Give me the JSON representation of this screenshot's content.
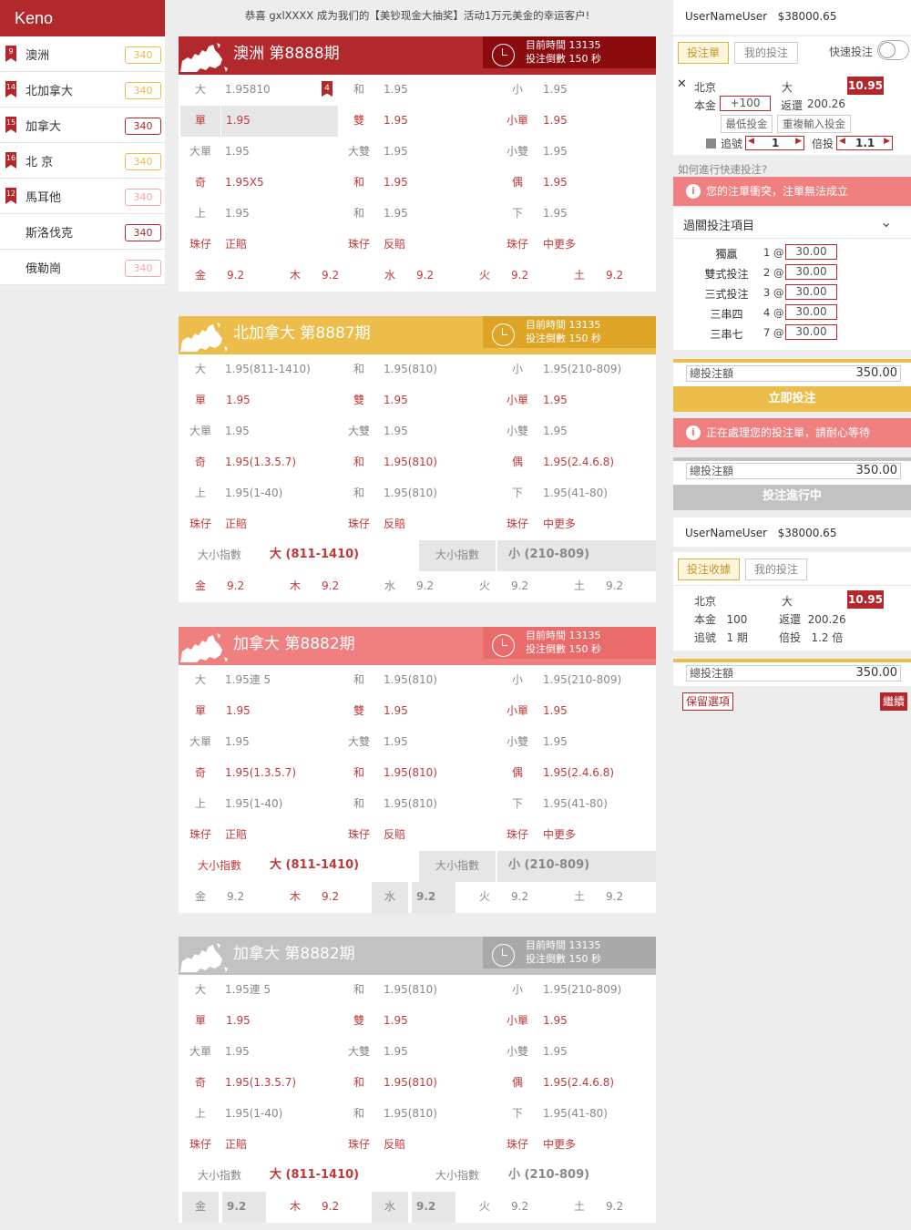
{
  "sidebar": {
    "title": "Keno",
    "items": [
      {
        "num": "9",
        "name": "澳洲",
        "badge": "340",
        "color": "#edbd4b"
      },
      {
        "num": "14",
        "name": "北加拿大",
        "badge": "340",
        "color": "#edbd4b"
      },
      {
        "num": "15",
        "name": "加拿大",
        "badge": "340",
        "color": "#b3282d"
      },
      {
        "num": "16",
        "name": "北 京",
        "badge": "340",
        "color": "#edbd4b"
      },
      {
        "num": "12",
        "name": "馬耳他",
        "badge": "340",
        "color": "#f3a9a9"
      },
      {
        "num": "",
        "name": "斯洛伐克",
        "badge": "340",
        "color": "#b3282d"
      },
      {
        "num": "",
        "name": "俄勒崗",
        "badge": "340",
        "color": "#f3a9a9"
      }
    ]
  },
  "notice": "恭喜 gxlXXXX 成为我们的【美钞现金大抽奖】活动1万元美金的幸运客户!",
  "panels": [
    {
      "title": "澳洲 第8888期",
      "timer1": "目前時間 13135",
      "timer2": "投注倒數 150 秒",
      "color": "#b3282d",
      "timer_color": "#8b0b0f",
      "r1": [
        "大",
        "1.95810",
        "4",
        "和",
        "1.95",
        "小",
        "1.95"
      ],
      "r2": [
        "單",
        "1.95",
        "雙",
        "1.95",
        "小單",
        "1.95"
      ],
      "r3": [
        "大單",
        "1.95",
        "大雙",
        "1.95",
        "小雙",
        "1.95"
      ],
      "r4": [
        "奇",
        "1.95X5",
        "和",
        "1.95",
        "偶",
        "1.95"
      ],
      "r5": [
        "上",
        "1.95",
        "和",
        "1.95",
        "下",
        "1.95"
      ],
      "r6": [
        "珠仔",
        "正賠",
        "珠仔",
        "反賠",
        "珠仔",
        "中更多"
      ],
      "r8": [
        "金",
        "9.2",
        "木",
        "9.2",
        "水",
        "9.2",
        "火",
        "9.2",
        "土",
        "9.2"
      ]
    },
    {
      "title": "北加拿大 第8887期",
      "timer1": "目前時間 13135",
      "timer2": "投注倒數 150 秒",
      "color": "#edbd4b",
      "timer_color": "#dea426",
      "r1": [
        "大",
        "1.95(811-1410)",
        "和",
        "1.95(810)",
        "小",
        "1.95(210-809)"
      ],
      "r2": [
        "單",
        "1.95",
        "雙",
        "1.95",
        "小單",
        "1.95"
      ],
      "r3": [
        "大單",
        "1.95",
        "大雙",
        "1.95",
        "小雙",
        "1.95"
      ],
      "r4": [
        "奇",
        "1.95(1.3.5.7)",
        "和",
        "1.95(810)",
        "偶",
        "1.95(2.4.6.8)"
      ],
      "r5": [
        "上",
        "1.95(1-40)",
        "和",
        "1.95(810)",
        "下",
        "1.95(41-80)"
      ],
      "r6": [
        "珠仔",
        "正賠",
        "珠仔",
        "反賠",
        "珠仔",
        "中更多"
      ],
      "r7": [
        "大小指數",
        "大 (811-1410)",
        "大小指數",
        "小 (210-809)"
      ],
      "r8": [
        "金",
        "9.2",
        "木",
        "9.2",
        "水",
        "9.2",
        "火",
        "9.2",
        "土",
        "9.2"
      ]
    },
    {
      "title": "加拿大 第8882期",
      "timer1": "目前時間 13135",
      "timer2": "投注倒數 150 秒",
      "color": "#f08080",
      "timer_color": "#ea6b6b",
      "r1": [
        "大",
        "1.95連 5",
        "和",
        "1.95(810)",
        "小",
        "1.95(210-809)"
      ],
      "r2": [
        "單",
        "1.95",
        "雙",
        "1.95",
        "小單",
        "1.95"
      ],
      "r3": [
        "大單",
        "1.95",
        "大雙",
        "1.95",
        "小雙",
        "1.95"
      ],
      "r4": [
        "奇",
        "1.95(1.3.5.7)",
        "和",
        "1.95(810)",
        "偶",
        "1.95(2.4.6.8)"
      ],
      "r5": [
        "上",
        "1.95(1-40)",
        "和",
        "1.95(810)",
        "下",
        "1.95(41-80)"
      ],
      "r6": [
        "珠仔",
        "正賠",
        "珠仔",
        "反賠",
        "珠仔",
        "中更多"
      ],
      "r7": [
        "大小指數",
        "大 (811-1410)",
        "大小指數",
        "小 (210-809)"
      ],
      "r8": [
        "金",
        "9.2",
        "木",
        "9.2",
        "水",
        "9.2",
        "火",
        "9.2",
        "土",
        "9.2"
      ]
    },
    {
      "title": "加拿大 第8882期",
      "timer1": "目前時間 13135",
      "timer2": "投注倒數 150 秒",
      "color": "#c2c2c2",
      "timer_color": "#a9a9a9",
      "r1": [
        "大",
        "1.95連 5",
        "和",
        "1.95(810)",
        "小",
        "1.95(210-809)"
      ],
      "r2": [
        "單",
        "1.95",
        "雙",
        "1.95",
        "小單",
        "1.95"
      ],
      "r3": [
        "大單",
        "1.95",
        "大雙",
        "1.95",
        "小雙",
        "1.95"
      ],
      "r4": [
        "奇",
        "1.95(1.3.5.7)",
        "和",
        "1.95(810)",
        "偶",
        "1.95(2.4.6.8)"
      ],
      "r5": [
        "上",
        "1.95(1-40)",
        "和",
        "1.95(810)",
        "下",
        "1.95(41-80)"
      ],
      "r6": [
        "珠仔",
        "正賠",
        "珠仔",
        "反賠",
        "珠仔",
        "中更多"
      ],
      "r7": [
        "大小指數",
        "大 (811-1410)",
        "大小指數",
        "小 (210-809)"
      ],
      "r8": [
        "金",
        "9.2",
        "木",
        "9.2",
        "水",
        "9.2",
        "火",
        "9.2",
        "土",
        "9.2"
      ]
    }
  ],
  "right": {
    "user": "UserNameUser",
    "balance": "$38000.65",
    "tab_slip": "投注單",
    "tab_mybets": "我的投注",
    "quick_label": "快速投注",
    "bet_region": "北京",
    "bet_pick": "大",
    "bet_price": "10.95",
    "stake_label": "本金",
    "stake_value": "+100",
    "return_label": "返還",
    "return_value": "200.26",
    "min_stake": "最低投金",
    "repeat_stake": "重複輸入投金",
    "chase_label": "追號",
    "chase_value": "1",
    "multi_label": "倍投",
    "multi_value": "1.1",
    "howto": "如何進行快速投注?",
    "alert1": "您的注單衝突，注單無法成立",
    "parlay_title": "過關投注項目",
    "parlay": [
      {
        "name": "獨贏",
        "count": "1 @",
        "amount": "30.00"
      },
      {
        "name": "雙式投注",
        "count": "2 @",
        "amount": "30.00"
      },
      {
        "name": "三式投注",
        "count": "3 @",
        "amount": "30.00"
      },
      {
        "name": "三串四",
        "count": "4 @",
        "amount": "30.00"
      },
      {
        "name": "三串七",
        "count": "7 @",
        "amount": "30.00"
      }
    ],
    "total_label": "總投注額",
    "total_value": "350.00",
    "bet_now": "立即投注",
    "alert2": "正在處理您的投注單，請耐心等待",
    "total2_label": "總投注額",
    "total2_value": "350.00",
    "in_progress": "投注進行中",
    "user2": "UserNameUser",
    "balance2": "$38000.65",
    "tab_receipt": "投注收據",
    "tab_mybets2": "我的投注",
    "r_region": "北京",
    "r_pick": "大",
    "r_price": "10.95",
    "r_stake_label": "本金",
    "r_stake": "100",
    "r_return_label": "返還",
    "r_return": "200.26",
    "r_chase_label": "追號",
    "r_chase": "1 期",
    "r_multi_label": "倍投",
    "r_multi": "1.2 倍",
    "total3_label": "總投注額",
    "total3_value": "350.00",
    "keep": "保留選項",
    "continue": "繼續"
  }
}
